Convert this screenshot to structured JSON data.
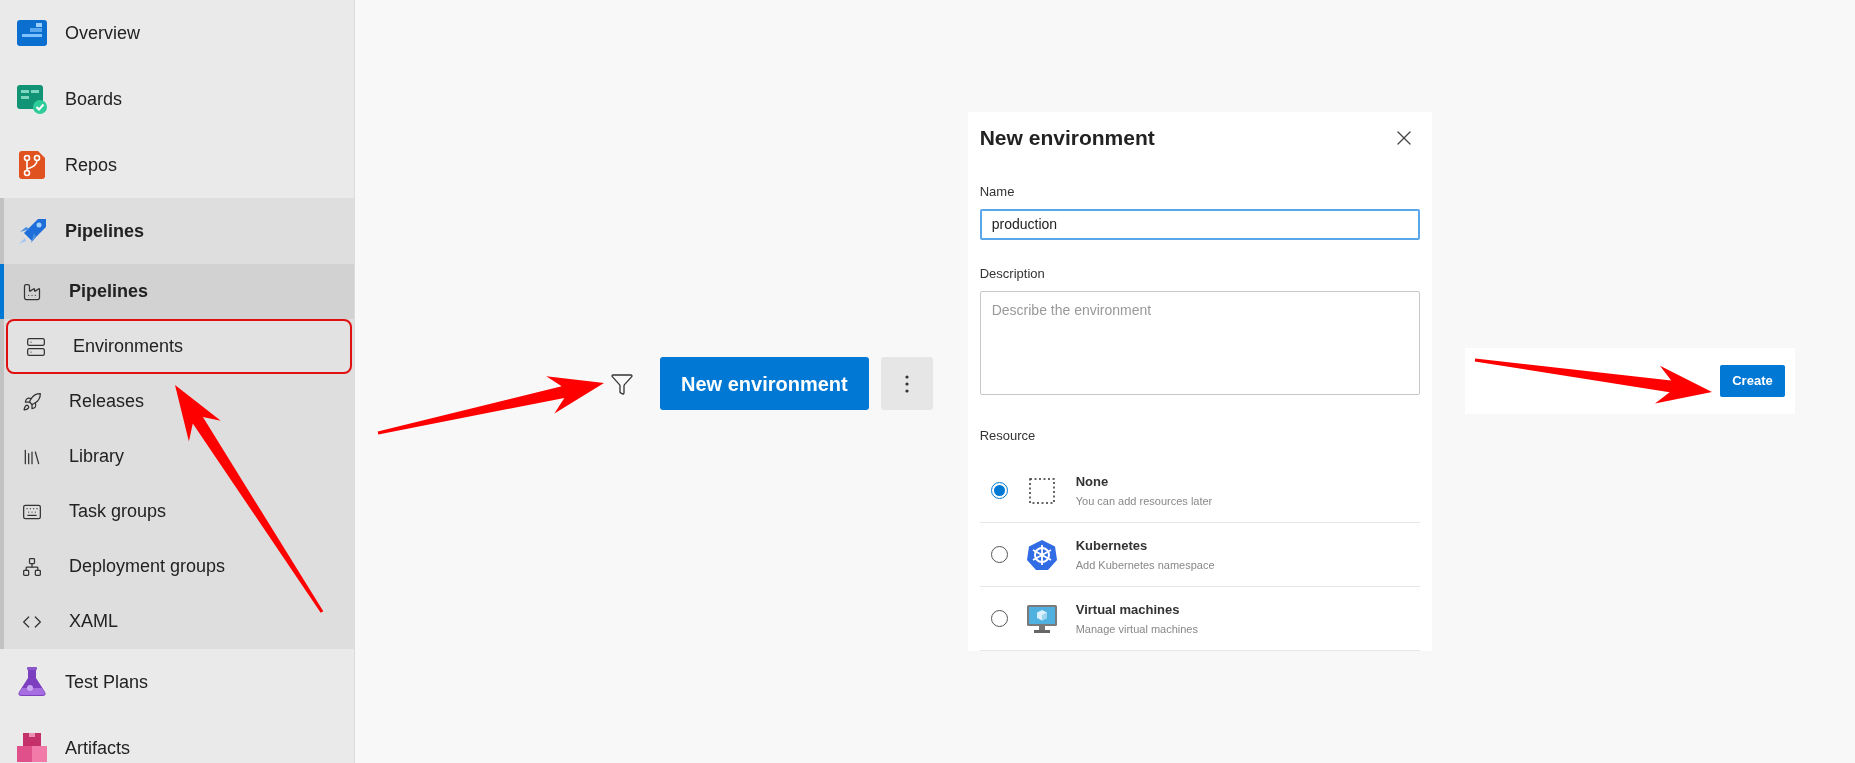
{
  "sidebar": {
    "items": [
      {
        "label": "Overview"
      },
      {
        "label": "Boards"
      },
      {
        "label": "Repos"
      },
      {
        "label": "Pipelines",
        "expanded": true,
        "children": [
          {
            "label": "Pipelines",
            "selected": true,
            "highlighted": false
          },
          {
            "label": "Environments",
            "selected": false,
            "highlighted": true
          },
          {
            "label": "Releases",
            "selected": false,
            "highlighted": false
          },
          {
            "label": "Library",
            "selected": false,
            "highlighted": false
          },
          {
            "label": "Task groups",
            "selected": false,
            "highlighted": false
          },
          {
            "label": "Deployment groups",
            "selected": false,
            "highlighted": false
          },
          {
            "label": "XAML",
            "selected": false,
            "highlighted": false
          }
        ]
      },
      {
        "label": "Test Plans"
      },
      {
        "label": "Artifacts"
      }
    ]
  },
  "toolbar": {
    "primary_button": "New environment"
  },
  "dialog": {
    "title": "New environment",
    "name": {
      "label": "Name",
      "value": "production"
    },
    "description": {
      "label": "Description",
      "placeholder": "Describe the environment"
    },
    "resource": {
      "label": "Resource",
      "options": [
        {
          "title": "None",
          "subtitle": "You can add resources later",
          "selected": true
        },
        {
          "title": "Kubernetes",
          "subtitle": "Add Kubernetes namespace",
          "selected": false
        },
        {
          "title": "Virtual machines",
          "subtitle": "Manage virtual machines",
          "selected": false
        }
      ]
    }
  },
  "create_button": "Create"
}
